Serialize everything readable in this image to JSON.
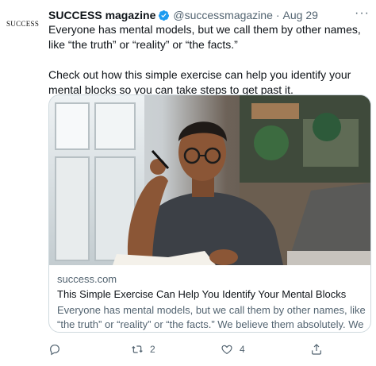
{
  "avatar": {
    "logo_text": "SUCCESS"
  },
  "header": {
    "name": "SUCCESS magazine",
    "handle": "@successmagazine",
    "separator": "·",
    "time": "Aug 29",
    "more_icon": "more-icon"
  },
  "tweet": {
    "paragraph1": "Everyone has mental models, but we call them by other names, like “the truth” or “reality” or “the facts.”",
    "paragraph2": "Check out how this simple exercise can help you identify your mental blocks so you can take steps to get past it."
  },
  "card": {
    "domain": "success.com",
    "title": "This Simple Exercise Can Help You Identify Your Mental Blocks",
    "description": "Everyone has mental models, but we call them by other names, like “the truth” or “reality” or “the facts.” We believe them absolutely. We ..."
  },
  "actions": {
    "reply_icon": "reply-icon",
    "retweet_icon": "retweet-icon",
    "retweet_count": "2",
    "like_icon": "heart-icon",
    "like_count": "4",
    "share_icon": "share-icon"
  },
  "colors": {
    "verified": "#1d9bf0",
    "secondary_text": "#536471",
    "card_border": "#cfd9de"
  }
}
